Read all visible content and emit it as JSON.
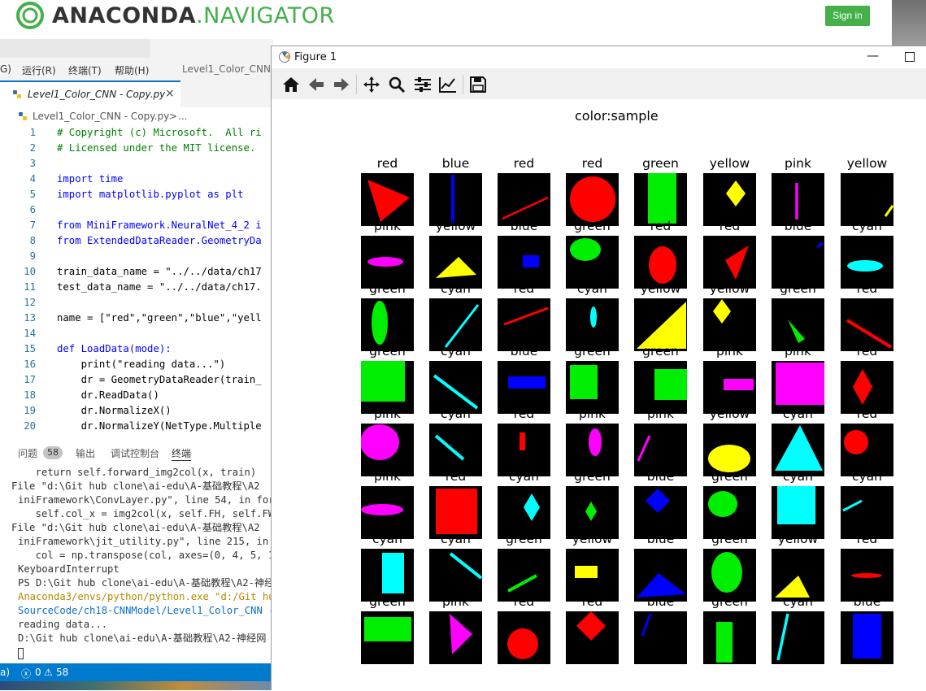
{
  "anaconda": {
    "brand_bold": "ANACONDA",
    "brand_light": ".NAVIGATOR",
    "signin_label": "Sign in"
  },
  "vscode": {
    "menu": [
      "G)",
      "运行(R)",
      "终端(T)",
      "帮助(H)",
      "Level1_Color_CNN -"
    ],
    "tab_label": "Level1_Color_CNN - Copy.py",
    "tab_close": "×",
    "breadcrumb": [
      "Level1_Color_CNN - Copy.py",
      ">",
      "..."
    ],
    "code": [
      {
        "n": "1",
        "t": "# Copyright (c) Microsoft.  All ri"
      },
      {
        "n": "2",
        "t": "# Licensed under the MIT license."
      },
      {
        "n": "3",
        "t": ""
      },
      {
        "n": "4",
        "t": "import time"
      },
      {
        "n": "5",
        "t": "import matplotlib.pyplot as plt"
      },
      {
        "n": "6",
        "t": ""
      },
      {
        "n": "7",
        "t": "from MiniFramework.NeuralNet_4_2 i"
      },
      {
        "n": "8",
        "t": "from ExtendedDataReader.GeometryDa"
      },
      {
        "n": "9",
        "t": ""
      },
      {
        "n": "10",
        "t": "train_data_name = \"../../data/ch17"
      },
      {
        "n": "11",
        "t": "test_data_name = \"../../data/ch17."
      },
      {
        "n": "12",
        "t": ""
      },
      {
        "n": "13",
        "t": "name = [\"red\",\"green\",\"blue\",\"yell"
      },
      {
        "n": "14",
        "t": ""
      },
      {
        "n": "15",
        "t": "def LoadData(mode):"
      },
      {
        "n": "16",
        "t": "    print(\"reading data...\")"
      },
      {
        "n": "17",
        "t": "    dr = GeometryDataReader(train_"
      },
      {
        "n": "18",
        "t": "    dr.ReadData()"
      },
      {
        "n": "19",
        "t": "    dr.NormalizeX()"
      },
      {
        "n": "20",
        "t": "    dr.NormalizeY(NetType.Multiple"
      }
    ],
    "panel_tabs": [
      "问题",
      "58",
      "输出",
      "调试控制台",
      "终端"
    ],
    "terminal": [
      "  return self.forward_img2col(x, train)",
      "File \"d:\\Git hub clone\\ai-edu\\A-基础教程\\A2",
      "iniFramework\\ConvLayer.py\", line 54, in forwa",
      "  self.col_x = img2col(x, self.FH, self.FW,",
      "File \"d:\\Git hub clone\\ai-edu\\A-基础教程\\A2",
      "iniFramework\\jit_utility.py\", line 215, in im",
      "  col = np.transpose(col, axes=(0, 4, 5, 1",
      "KeyboardInterrupt",
      "PS D:\\Git hub clone\\ai-edu\\A-基础教程\\A2-神经",
      "Anaconda3/envs/python/python.exe \"d:/Git hub",
      "SourceCode/ch18-CNNModel/Level1_Color_CNN - C",
      "reading data...",
      "D:\\Git hub clone\\ai-edu\\A-基础教程\\A2-神经网"
    ],
    "status": {
      "left": "a)",
      "errors": "0",
      "warnings": "58"
    }
  },
  "figure": {
    "window_title": "Figure 1",
    "suptitle": "color:sample",
    "labels": [
      [
        "red",
        "blue",
        "red",
        "red",
        "green",
        "yellow",
        "pink",
        "yellow"
      ],
      [
        "pink",
        "yellow",
        "blue",
        "green",
        "red",
        "red",
        "blue",
        "cyan"
      ],
      [
        "green",
        "cyan",
        "red",
        "cyan",
        "yellow",
        "yellow",
        "green",
        "red"
      ],
      [
        "green",
        "cyan",
        "blue",
        "green",
        "green",
        "pink",
        "pink",
        "red"
      ],
      [
        "pink",
        "cyan",
        "red",
        "pink",
        "pink",
        "yellow",
        "cyan",
        "red"
      ],
      [
        "pink",
        "red",
        "cyan",
        "green",
        "blue",
        "green",
        "cyan",
        "cyan"
      ],
      [
        "cyan",
        "cyan",
        "green",
        "yellow",
        "blue",
        "green",
        "yellow",
        "red"
      ],
      [
        "green",
        "pink",
        "red",
        "red",
        "blue",
        "green",
        "cyan",
        "blue"
      ]
    ],
    "shape_colors": {
      "red": "#ff0000",
      "blue": "#0000ff",
      "green": "#00ee00",
      "yellow": "#ffff00",
      "pink": "#ff00ff",
      "cyan": "#00ffff"
    },
    "toolbar_icons": [
      "home-icon",
      "back-icon",
      "forward-icon",
      "pan-icon",
      "zoom-icon",
      "configure-icon",
      "edit-axes-icon",
      "save-icon"
    ]
  }
}
